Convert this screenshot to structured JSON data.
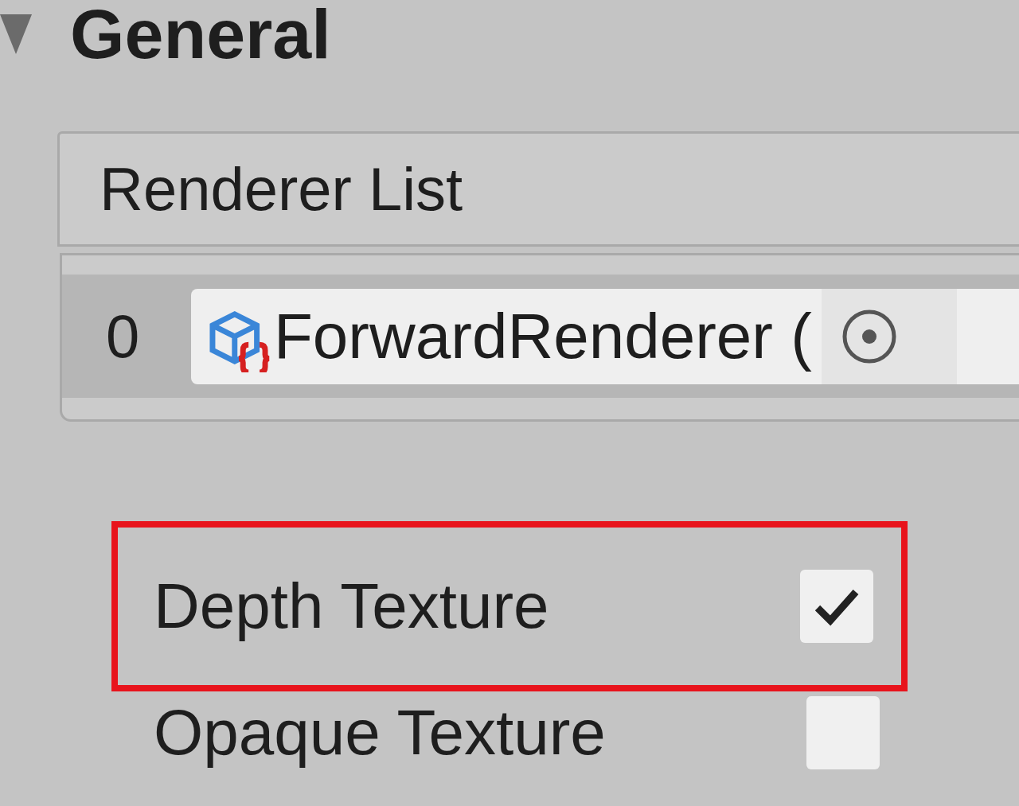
{
  "section": {
    "title": "General",
    "expanded": true
  },
  "renderer_list": {
    "header": "Renderer List",
    "items": [
      {
        "index": "0",
        "value": "ForwardRenderer ("
      }
    ]
  },
  "settings": [
    {
      "label": "Depth Texture",
      "checked": true,
      "highlighted": true
    },
    {
      "label": "Opaque Texture",
      "checked": false,
      "highlighted": false
    }
  ]
}
